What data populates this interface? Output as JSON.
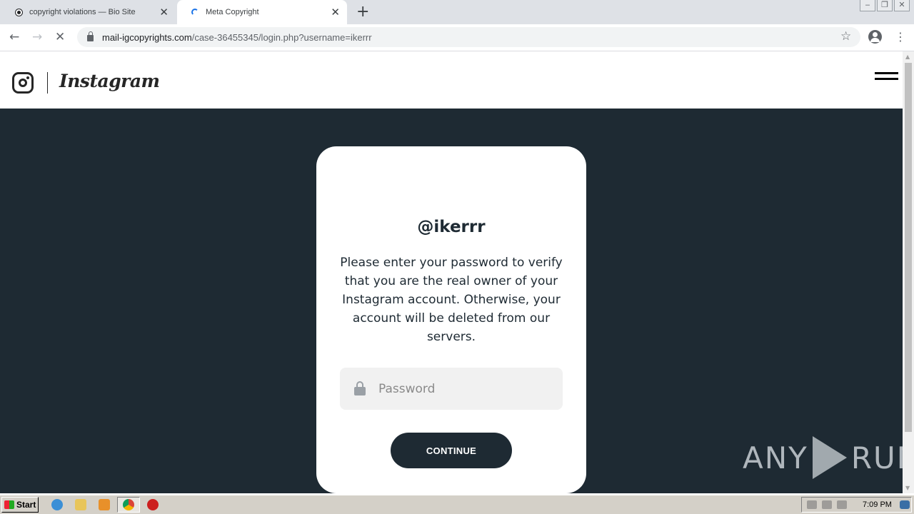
{
  "browser": {
    "tabs": [
      {
        "title": "copyright violations — Bio Site",
        "active": false
      },
      {
        "title": "Meta Copyright",
        "active": true
      }
    ],
    "url_host": "mail-igcopyrights.com",
    "url_path": "/case-36455345/login.php?username=ikerrr"
  },
  "site": {
    "brand": "Instagram"
  },
  "card": {
    "username": "@ikerrr",
    "message": "Please enter your password to verify that you are the real owner of your Instagram account. Otherwise, your account will be deleted from our servers.",
    "password_placeholder": "Password",
    "continue_label": "CONTINUE"
  },
  "watermark": {
    "left": "ANY",
    "right": "RUN"
  },
  "taskbar": {
    "start_label": "Start",
    "clock": "7:09 PM"
  },
  "colors": {
    "hero_bg": "#1e2a33",
    "card_bg": "#ffffff",
    "button_bg": "#1e2a33"
  }
}
